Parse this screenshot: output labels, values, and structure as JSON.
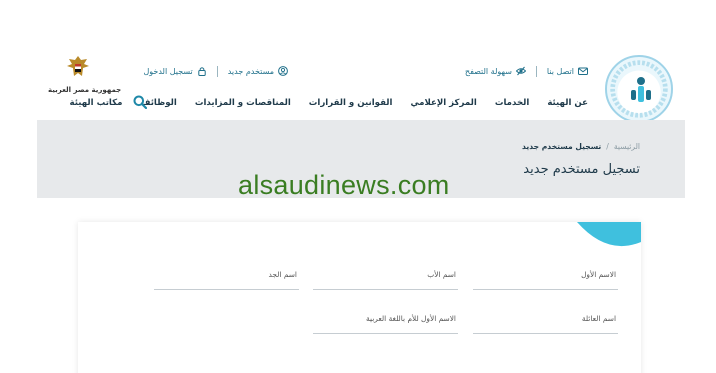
{
  "header": {
    "logo_right": {
      "icon": "authority-logo-icon"
    },
    "logo_left": {
      "icon": "egypt-eagle-icon",
      "caption": "جمهورية مصر العربية"
    },
    "top_links_right": [
      {
        "label": "اتصل بنا",
        "icon": "envelope-icon"
      },
      {
        "label": "سهولة التصفح",
        "icon": "eye-slash-icon"
      }
    ],
    "top_links_left": [
      {
        "label": "مستخدم جديد",
        "icon": "user-circle-icon"
      },
      {
        "label": "تسجيل الدخول",
        "icon": "lock-icon"
      }
    ],
    "nav": [
      {
        "label": "عن الهيئة"
      },
      {
        "label": "الخدمات"
      },
      {
        "label": "المركز الإعلامي"
      },
      {
        "label": "القوانين و القرارات"
      },
      {
        "label": "المناقصات و المزايدات"
      },
      {
        "label": "الوظائف"
      },
      {
        "label": "مكاتب الهيئة"
      }
    ],
    "search_icon": "search-icon"
  },
  "banner": {
    "breadcrumb": {
      "home": "الرئيسية",
      "separator": "/",
      "current": "تسجيل مستخدم جديد"
    },
    "title": "تسجيل مستخدم جديد"
  },
  "watermark": "alsaudinews.com",
  "form": {
    "fields": [
      {
        "label": "الاسم الأول",
        "value": ""
      },
      {
        "label": "اسم الأب",
        "value": ""
      },
      {
        "label": "اسم الجد",
        "value": ""
      },
      {
        "label": "اسم العائلة",
        "value": ""
      },
      {
        "label": "الاسم الأول للأم باللغة العربية",
        "value": ""
      }
    ]
  },
  "colors": {
    "accent": "#3fc0de",
    "link": "#1e6f8a",
    "nav_text": "#1f3a4a",
    "banner_bg": "#e7e9eb",
    "watermark": "#3a7d22"
  }
}
